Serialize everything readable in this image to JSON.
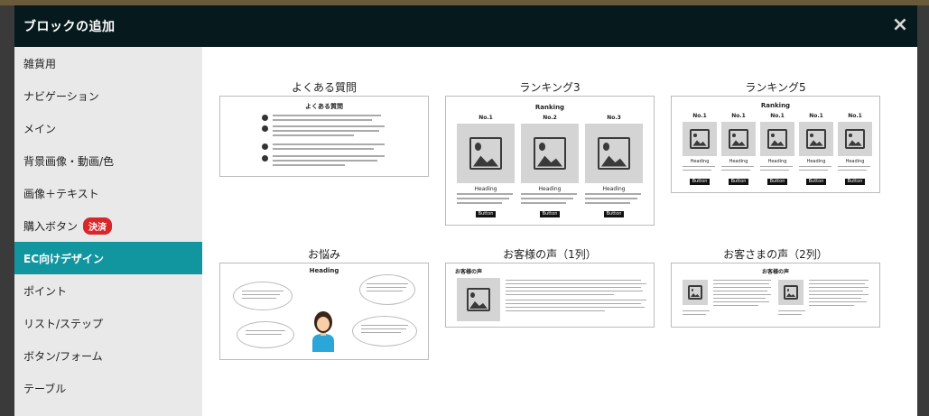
{
  "modal": {
    "title": "ブロックの追加",
    "close_label": "×"
  },
  "sidebar": {
    "items": [
      {
        "label": "雑貨用",
        "active": false
      },
      {
        "label": "ナビゲーション",
        "active": false
      },
      {
        "label": "メイン",
        "active": false
      },
      {
        "label": "背景画像・動画/色",
        "active": false
      },
      {
        "label": "画像＋テキスト",
        "active": false
      },
      {
        "label": "購入ボタン",
        "active": false,
        "badge": "決済"
      },
      {
        "label": "EC向けデザイン",
        "active": true
      },
      {
        "label": "ポイント",
        "active": false
      },
      {
        "label": "リスト/ステップ",
        "active": false
      },
      {
        "label": "ボタン/フォーム",
        "active": false
      },
      {
        "label": "テーブル",
        "active": false
      }
    ]
  },
  "cards": [
    {
      "title": "よくある質問",
      "thumb_heading": "よくある質問"
    },
    {
      "title": "ランキング3",
      "thumb_heading": "Ranking",
      "ranks": [
        "No.1",
        "No.2",
        "No.3"
      ],
      "item_heading": "Heading",
      "button": "Button"
    },
    {
      "title": "ランキング5",
      "thumb_heading": "Ranking",
      "ranks": [
        "No.1",
        "No.1",
        "No.1",
        "No.1",
        "No.1"
      ],
      "item_heading": "Heading",
      "button": "Button"
    },
    {
      "title": "お悩み",
      "thumb_heading": "Heading"
    },
    {
      "title": "お客様の声（1列）",
      "thumb_heading": "お客様の声"
    },
    {
      "title": "お客さまの声（2列）",
      "thumb_heading": "お客様の声"
    }
  ],
  "colors": {
    "header_bg": "#061a1e",
    "active_bg": "#11959f",
    "badge_bg": "#d9262b",
    "sidebar_bg": "#e9e9e9"
  }
}
